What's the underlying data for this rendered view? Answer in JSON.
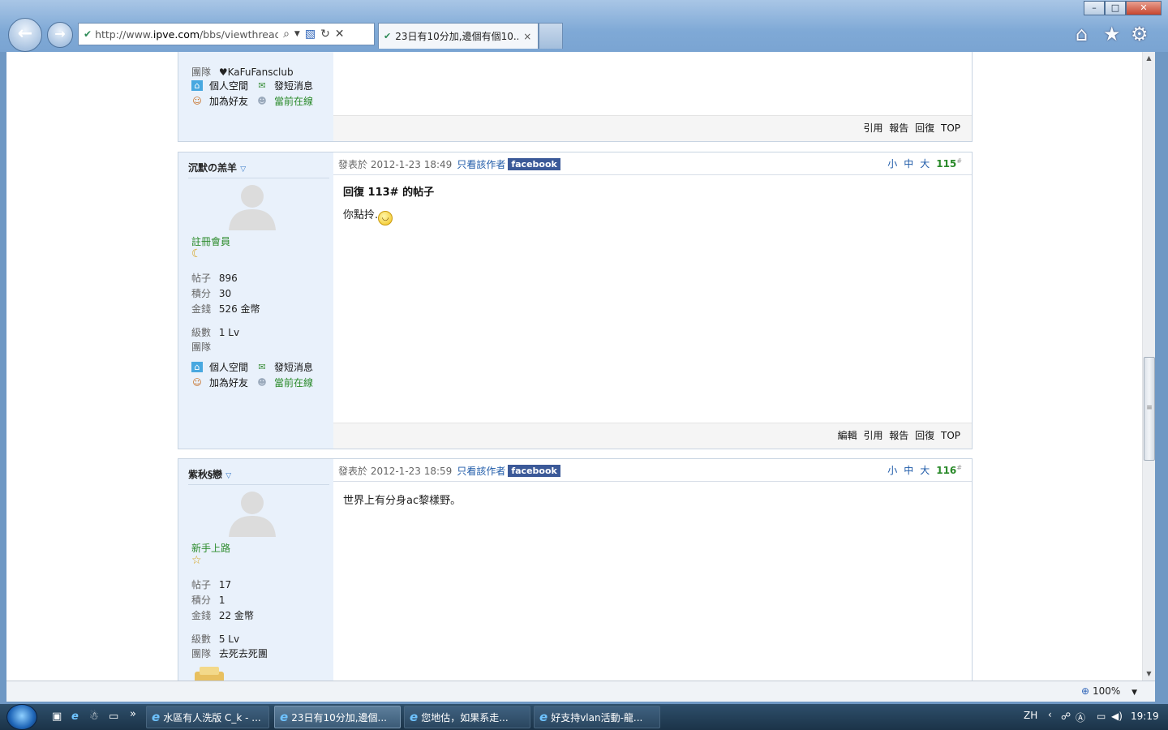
{
  "browser": {
    "url_prefix": "http://www.",
    "url_domain": "ipve.com",
    "url_rest": "/bbs/viewthread.p",
    "tab_title": "23日有10分加,邊個有個10...",
    "tab_close": "×",
    "zoom": "100%",
    "min_label": "–",
    "max_label": "□",
    "close_label": "✕"
  },
  "posts": [
    {
      "partial": true,
      "team_label": "團隊",
      "team_value": "♥KaFuFansclub",
      "actions": [
        "個人空間",
        "發短消息",
        "加為好友",
        "當前在線"
      ],
      "footer": [
        "引用",
        "報告",
        "回復",
        "TOP"
      ]
    },
    {
      "username": "沉默の羔羊",
      "rank": "註冊會員",
      "posts_label": "帖子",
      "posts_value": "896",
      "credits_label": "積分",
      "credits_value": "30",
      "money_label": "金錢",
      "money_value": "526 金幣",
      "level_label": "級數",
      "level_value": "1 Lv",
      "team_label": "團隊",
      "team_value": "",
      "actions": [
        "個人空間",
        "發短消息",
        "加為好友",
        "當前在線"
      ],
      "posted_at": "發表於 2012-1-23 18:49",
      "author_only": "只看該作者",
      "facebook": "facebook",
      "sizes": [
        "小",
        "中",
        "大"
      ],
      "floor": "115",
      "floor_sup": "#",
      "title": "回復 113# 的帖子",
      "text": "你點拎.",
      "footer": [
        "編輯",
        "引用",
        "報告",
        "回復",
        "TOP"
      ]
    },
    {
      "username": "紫秋§戀",
      "rank": "新手上路",
      "posts_label": "帖子",
      "posts_value": "17",
      "credits_label": "積分",
      "credits_value": "1",
      "money_label": "金錢",
      "money_value": "22 金幣",
      "level_label": "級數",
      "level_value": "5 Lv",
      "team_label": "團隊",
      "team_value": "去死去死團",
      "posted_at": "發表於 2012-1-23 18:59",
      "author_only": "只看該作者",
      "facebook": "facebook",
      "sizes": [
        "小",
        "中",
        "大"
      ],
      "floor": "116",
      "floor_sup": "#",
      "text": "世界上有分身ac黎樣野。"
    }
  ],
  "taskbar": {
    "tasks": [
      "水區有人洗版 C_k - ...",
      "23日有10分加,邊個...",
      "您地估，如果系走...",
      "好支持vlan活動-龍..."
    ],
    "more": "»",
    "lang": "ZH",
    "tray_arrow": "‹",
    "time": "19:19"
  }
}
